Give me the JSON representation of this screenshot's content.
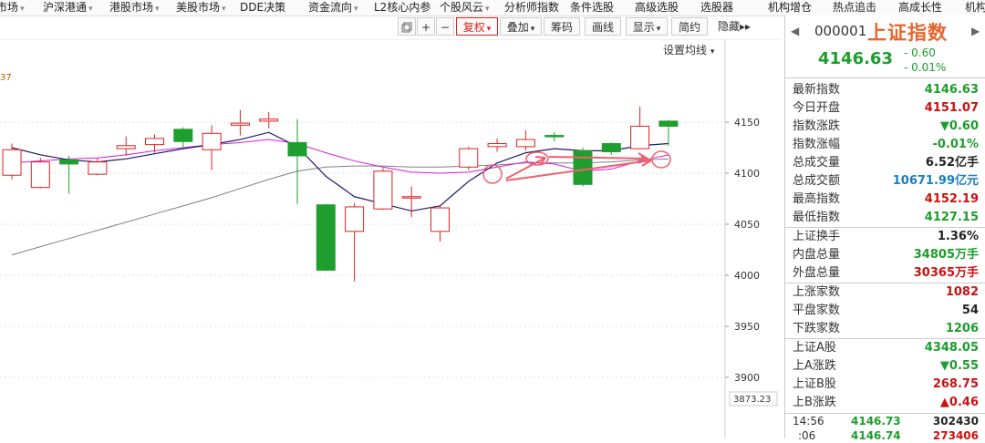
{
  "nav": [
    "市场",
    "沪深港通",
    "港股市场",
    "美股市场",
    "DDE决策",
    "资金流向",
    "L2核心内参",
    "个股风云",
    "分析师指数",
    "条件选股",
    "高级选股",
    "选股器",
    "机构增仓",
    "热点追击",
    "高成长性",
    "机构"
  ],
  "nav_arrow": "▾",
  "toolbar": {
    "restore_icon": "restore-icon",
    "plus": "+",
    "minus": "−",
    "fuquan": "复权",
    "overlay": "叠加",
    "chips": "筹码",
    "draw": "画线",
    "display": "显示",
    "simple": "简约",
    "hide": "隐藏",
    "more": "▸▸",
    "caret": "▾"
  },
  "ma_setting": "设置均线",
  "ma_label_fragment": "37",
  "chart_data": {
    "type": "candlestick",
    "ylim": [
      3873.23,
      4200
    ],
    "y_ticks": [
      4150,
      4100,
      4050,
      4000,
      3950,
      3900
    ],
    "bottom_value": "3873.23",
    "candles": [
      {
        "o": 4098,
        "c": 4123,
        "h": 4129,
        "l": 4094
      },
      {
        "o": 4086,
        "c": 4111,
        "h": 4115,
        "l": 4085
      },
      {
        "o": 4113,
        "c": 4109,
        "h": 4117,
        "l": 4080
      },
      {
        "o": 4099,
        "c": 4111,
        "h": 4115,
        "l": 4098
      },
      {
        "o": 4124,
        "c": 4127,
        "h": 4136,
        "l": 4117
      },
      {
        "o": 4128,
        "c": 4134,
        "h": 4138,
        "l": 4120
      },
      {
        "o": 4143,
        "c": 4131,
        "h": 4145,
        "l": 4125
      },
      {
        "o": 4123,
        "c": 4139,
        "h": 4147,
        "l": 4103
      },
      {
        "o": 4147,
        "c": 4149,
        "h": 4162,
        "l": 4137
      },
      {
        "o": 4151,
        "c": 4153,
        "h": 4160,
        "l": 4144
      },
      {
        "o": 4130,
        "c": 4117,
        "h": 4153,
        "l": 4070
      },
      {
        "o": 4069,
        "c": 4005,
        "h": 4070,
        "l": 4004
      },
      {
        "o": 4043,
        "c": 4067,
        "h": 4071,
        "l": 3994
      },
      {
        "o": 4065,
        "c": 4102,
        "h": 4105,
        "l": 4064
      },
      {
        "o": 4077,
        "c": 4077,
        "h": 4087,
        "l": 4057
      },
      {
        "o": 4043,
        "c": 4066,
        "h": 4068,
        "l": 4033
      },
      {
        "o": 4106,
        "c": 4124,
        "h": 4126,
        "l": 4103
      },
      {
        "o": 4126,
        "c": 4129,
        "h": 4134,
        "l": 4121
      },
      {
        "o": 4126,
        "c": 4133,
        "h": 4142,
        "l": 4122
      },
      {
        "o": 4137,
        "c": 4136,
        "h": 4140,
        "l": 4131
      },
      {
        "o": 4122,
        "c": 4089,
        "h": 4125,
        "l": 4087
      },
      {
        "o": 4129,
        "c": 4121,
        "h": 4130,
        "l": 4118
      },
      {
        "o": 4124,
        "c": 4146,
        "h": 4165,
        "l": 4124
      },
      {
        "o": 4151,
        "c": 4146,
        "h": 4152,
        "l": 4127
      }
    ],
    "ma_short": [
      4125,
      4118,
      4113,
      4111,
      4114,
      4119,
      4124,
      4128,
      4133,
      4140,
      4126,
      4097,
      4077,
      4070,
      4063,
      4068,
      4092,
      4110,
      4120,
      4124,
      4122,
      4122,
      4127,
      4129
    ],
    "ma_mid": [
      4110,
      4112,
      4114,
      4115,
      4118,
      4122,
      4125,
      4128,
      4130,
      4133,
      4129,
      4120,
      4112,
      4106,
      4101,
      4100,
      4101,
      4106,
      4111,
      4109,
      4102,
      4104,
      4112,
      4118
    ],
    "ma_long": [
      4020,
      4028,
      4036,
      4044,
      4052,
      4060,
      4068,
      4076,
      4085,
      4094,
      4102,
      4106,
      4107,
      4107,
      4106,
      4106,
      4107,
      4108,
      4110,
      4110,
      4110,
      4111,
      4113,
      4114
    ],
    "colors": {
      "up": "#e02020",
      "down": "#1e9e2e",
      "ma_short": "#1a1a6e",
      "ma_mid": "#d61ed6",
      "ma_long": "#808080",
      "annotation": "#f06070",
      "grid": "#e0e0e0"
    }
  },
  "panel": {
    "code": "000001",
    "name": "上证指数",
    "price": "4146.63",
    "change": "- 0.60",
    "change_pct": "- 0.01%",
    "prev_arrow": "◀",
    "next_arrow": "▶",
    "group1": [
      {
        "label": "最新指数",
        "value": "4146.63",
        "cls": "g"
      },
      {
        "label": "今日开盘",
        "value": "4151.07",
        "cls": "r"
      },
      {
        "label": "指数涨跌",
        "value": "▼0.60",
        "cls": "g"
      },
      {
        "label": "指数涨幅",
        "value": "-0.01%",
        "cls": "g"
      },
      {
        "label": "总成交量",
        "value": "6.52亿手",
        "cls": "k"
      },
      {
        "label": "总成交额",
        "value": "10671.99亿元",
        "cls": "b"
      },
      {
        "label": "最高指数",
        "value": "4152.19",
        "cls": "r"
      },
      {
        "label": "最低指数",
        "value": "4127.15",
        "cls": "g"
      }
    ],
    "group2": [
      {
        "label": "上证换手",
        "value": "1.36%",
        "cls": "k"
      },
      {
        "label": "内盘总量",
        "value": "34805万手",
        "cls": "g"
      },
      {
        "label": "外盘总量",
        "value": "30365万手",
        "cls": "r"
      }
    ],
    "group3": [
      {
        "label": "上涨家数",
        "value": "1082",
        "cls": "r"
      },
      {
        "label": "平盘家数",
        "value": "54",
        "cls": "k"
      },
      {
        "label": "下跌家数",
        "value": "1206",
        "cls": "g"
      }
    ],
    "group4": [
      {
        "label": "上证A股",
        "value": "4348.05",
        "cls": "g"
      },
      {
        "label": "上A涨跌",
        "value": "▼0.55",
        "cls": "g"
      },
      {
        "label": "上证B股",
        "value": "268.75",
        "cls": "r"
      },
      {
        "label": "上B涨跌",
        "value": "▲0.46",
        "cls": "r"
      }
    ],
    "ticks": [
      {
        "time": "14:56",
        "price": "4146.73",
        "vol": "302430"
      },
      {
        "time": ":06",
        "price": "4146.74",
        "vol": "273406"
      }
    ]
  }
}
